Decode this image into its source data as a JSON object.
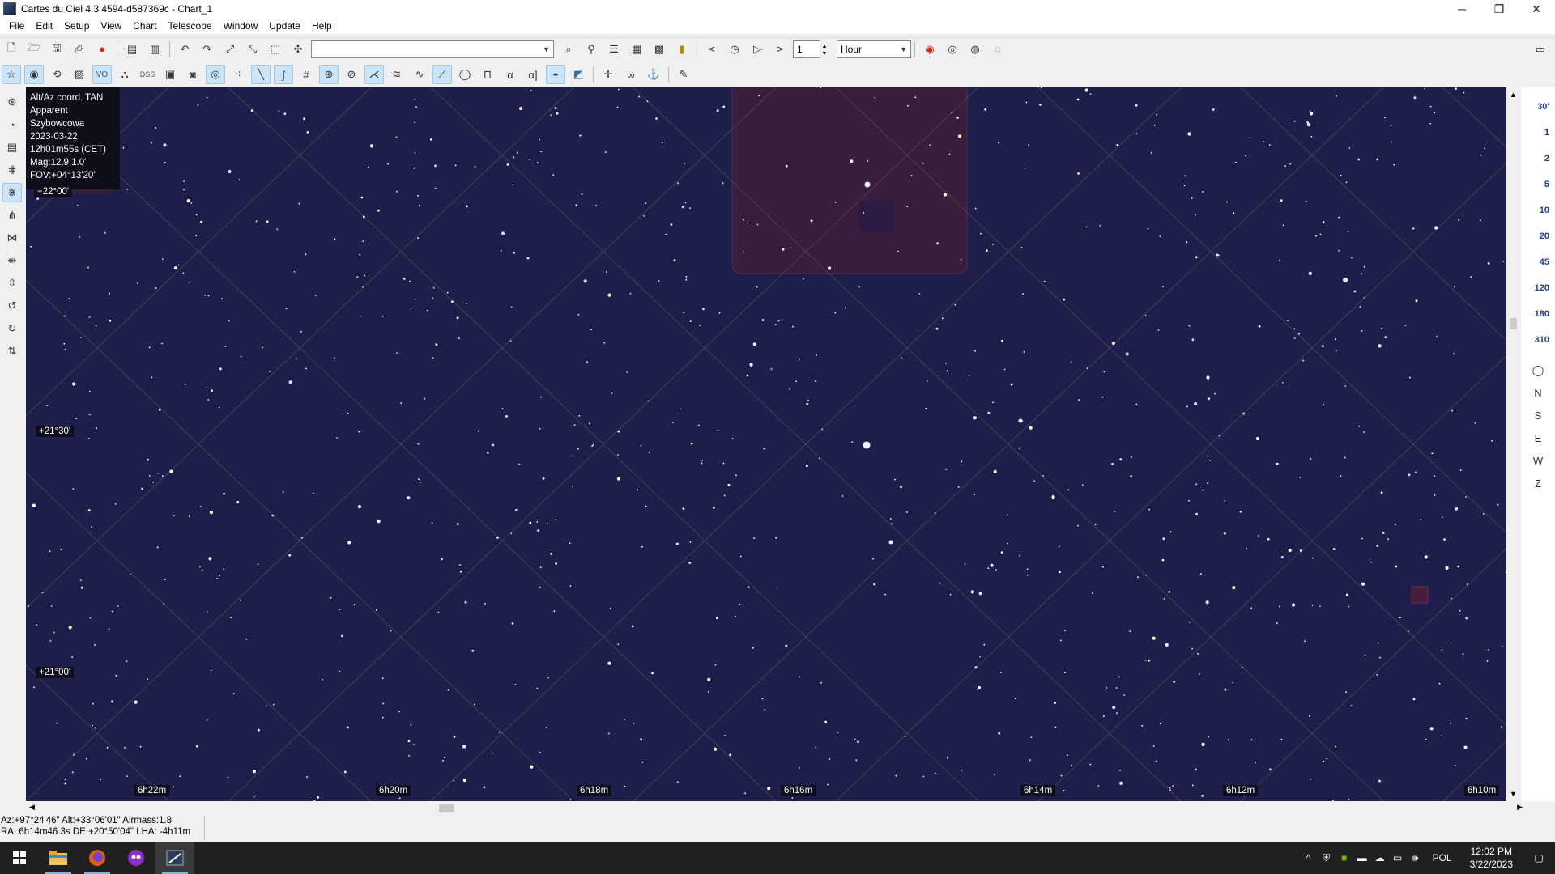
{
  "window": {
    "title": "Cartes du Ciel 4.3 4594-d587369c - Chart_1",
    "minimize": "─",
    "maximize": "❐",
    "close": "✕"
  },
  "menu": [
    "File",
    "Edit",
    "Setup",
    "View",
    "Chart",
    "Telescope",
    "Window",
    "Update",
    "Help"
  ],
  "toolbar": {
    "search_value": "",
    "step_value": "1",
    "time_unit": "Hour",
    "dss_label": "DSS",
    "vo_label": "VO",
    "alpha_label": "α",
    "alpha_bracket_label": "α]"
  },
  "info": {
    "projection": "Alt/Az coord. TAN",
    "mode": "Apparent",
    "location": "Szybowcowa",
    "date": "2023-03-22",
    "time": "12h01m55s (CET)",
    "mag": "Mag:12.9,1.0'",
    "fov": "FOV:+04°13'20\""
  },
  "chart_labels": {
    "dec": [
      "+22°00'",
      "+21°30'",
      "+21°00'"
    ],
    "ra": [
      "6h22m",
      "6h20m",
      "6h18m",
      "6h16m",
      "6h14m",
      "6h12m",
      "6h10m"
    ]
  },
  "fov_buttons": [
    "30'",
    "1",
    "2",
    "5",
    "10",
    "20",
    "45",
    "120",
    "180",
    "310"
  ],
  "dir_buttons": [
    "◯",
    "N",
    "S",
    "E",
    "W",
    "Z"
  ],
  "status": {
    "line1": "Az:+97°24'46\" Alt:+33°06'01\" Airmass:1.8",
    "line2": "RA:  6h14m46.3s DE:+20°50'04\"  LHA: -4h11m"
  },
  "taskbar": {
    "lang": "POL",
    "time": "12:02 PM",
    "date": "3/22/2023"
  },
  "colors": {
    "sky": "#1e1e4b",
    "grid": "#6b6b5a",
    "highlight": "#3a1c3c"
  }
}
